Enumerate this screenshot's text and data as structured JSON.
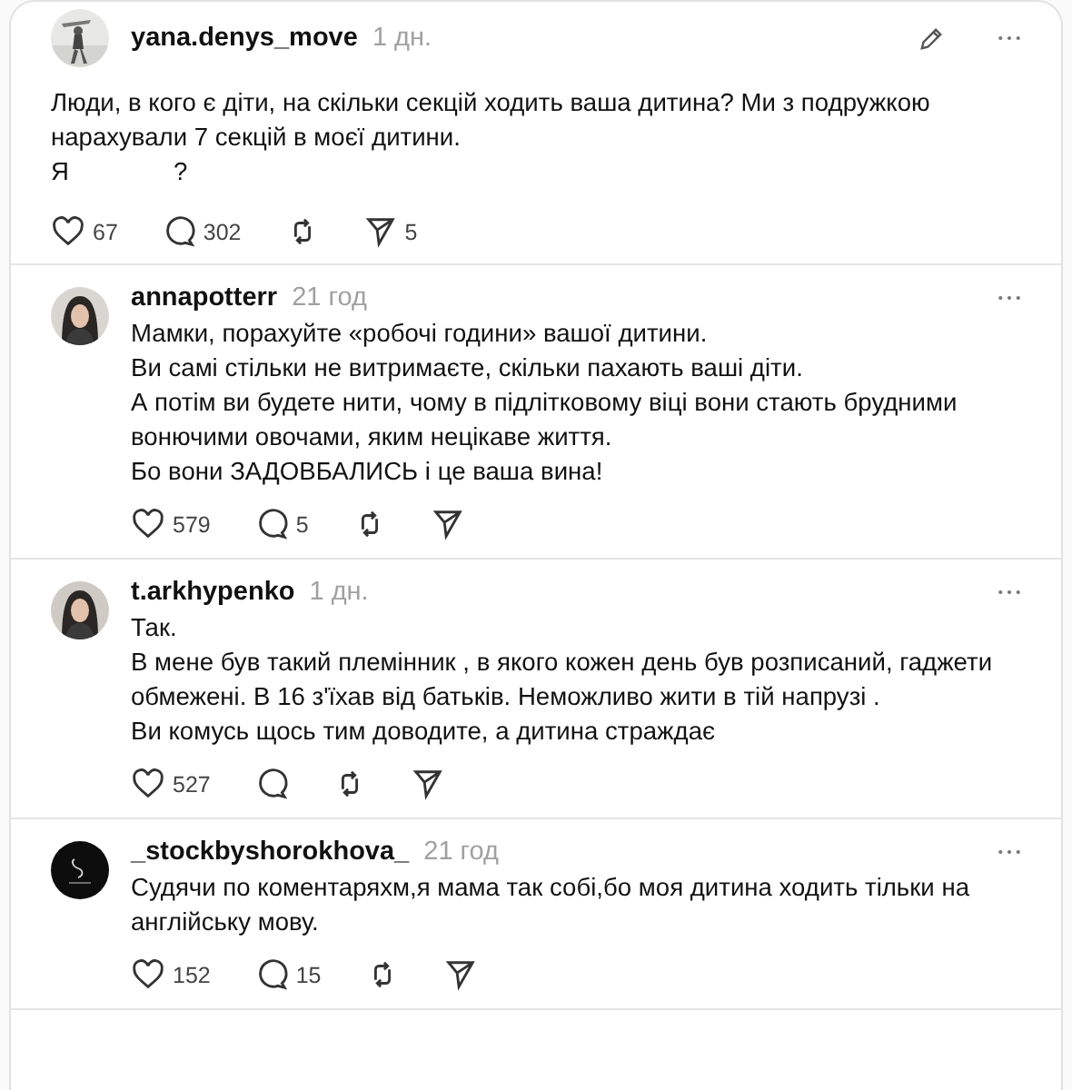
{
  "post": {
    "author": "yana.denys_move",
    "time": "1 дн.",
    "lines": [
      "Люди, в кого є діти, на скільки секцій ходить ваша дитина? Ми з подружкою нарахували 7 секцій в моєї дитини.",
      "Я               ?"
    ],
    "likes": "67",
    "replies": "302",
    "shares": "5"
  },
  "comments": [
    {
      "author": "annapotterr",
      "time": "21 год",
      "avatar": {
        "kind": "picture"
      },
      "lines": [
        "Мамки, порахуйте «робочі години» вашої дитини.",
        "Ви самі стільки не витримаєте, скільки пахають ваші діти.",
        "А потім ви будете нити, чому в підлітковому віці вони стають брудними вонючими овочами, яким нецікаве життя.",
        "Бо вони ЗАДОВБАЛИСЬ і це ваша вина!"
      ],
      "likes": "579",
      "replies": "5"
    },
    {
      "author": "t.arkhypenko",
      "time": "1 дн.",
      "avatar": {
        "kind": "picture"
      },
      "lines": [
        "Так.",
        "В мене був такий племінник , в якого кожен день був розписаний, гаджети обмежені. В 16 з'їхав від батьків. Неможливо жити в тій напрузі .",
        "Ви комусь щось тим доводите, а дитина страждає"
      ],
      "likes": "527"
    },
    {
      "author": "_stockbyshorokhova_",
      "time": "21 год",
      "avatar": {
        "kind": "logo"
      },
      "lines": [
        "Судячи по коментаряхм,я мама так собі,бо моя дитина ходить тільки на англійську мову."
      ],
      "likes": "152",
      "replies": "15"
    }
  ]
}
